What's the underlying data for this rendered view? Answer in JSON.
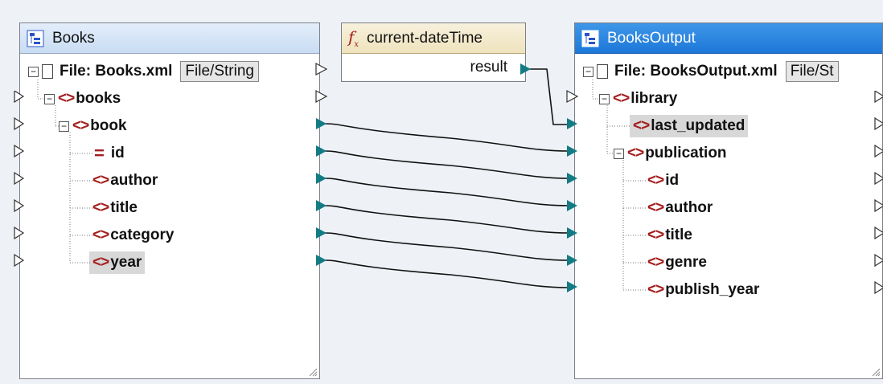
{
  "source": {
    "title": "Books",
    "file_label": "File: Books.xml",
    "file_button": "File/String",
    "nodes": [
      "books",
      "book",
      "id",
      "author",
      "title",
      "category",
      "year"
    ]
  },
  "function": {
    "title": "current-dateTime",
    "output": "result"
  },
  "target": {
    "title": "BooksOutput",
    "file_label": "File: BooksOutput.xml",
    "file_button": "File/St",
    "nodes": [
      "library",
      "last_updated",
      "publication",
      "id",
      "author",
      "title",
      "genre",
      "publish_year"
    ]
  },
  "colors": {
    "connector": "#127b84",
    "element_icon": "#a41e1e",
    "header_active": "#2a84e0"
  }
}
